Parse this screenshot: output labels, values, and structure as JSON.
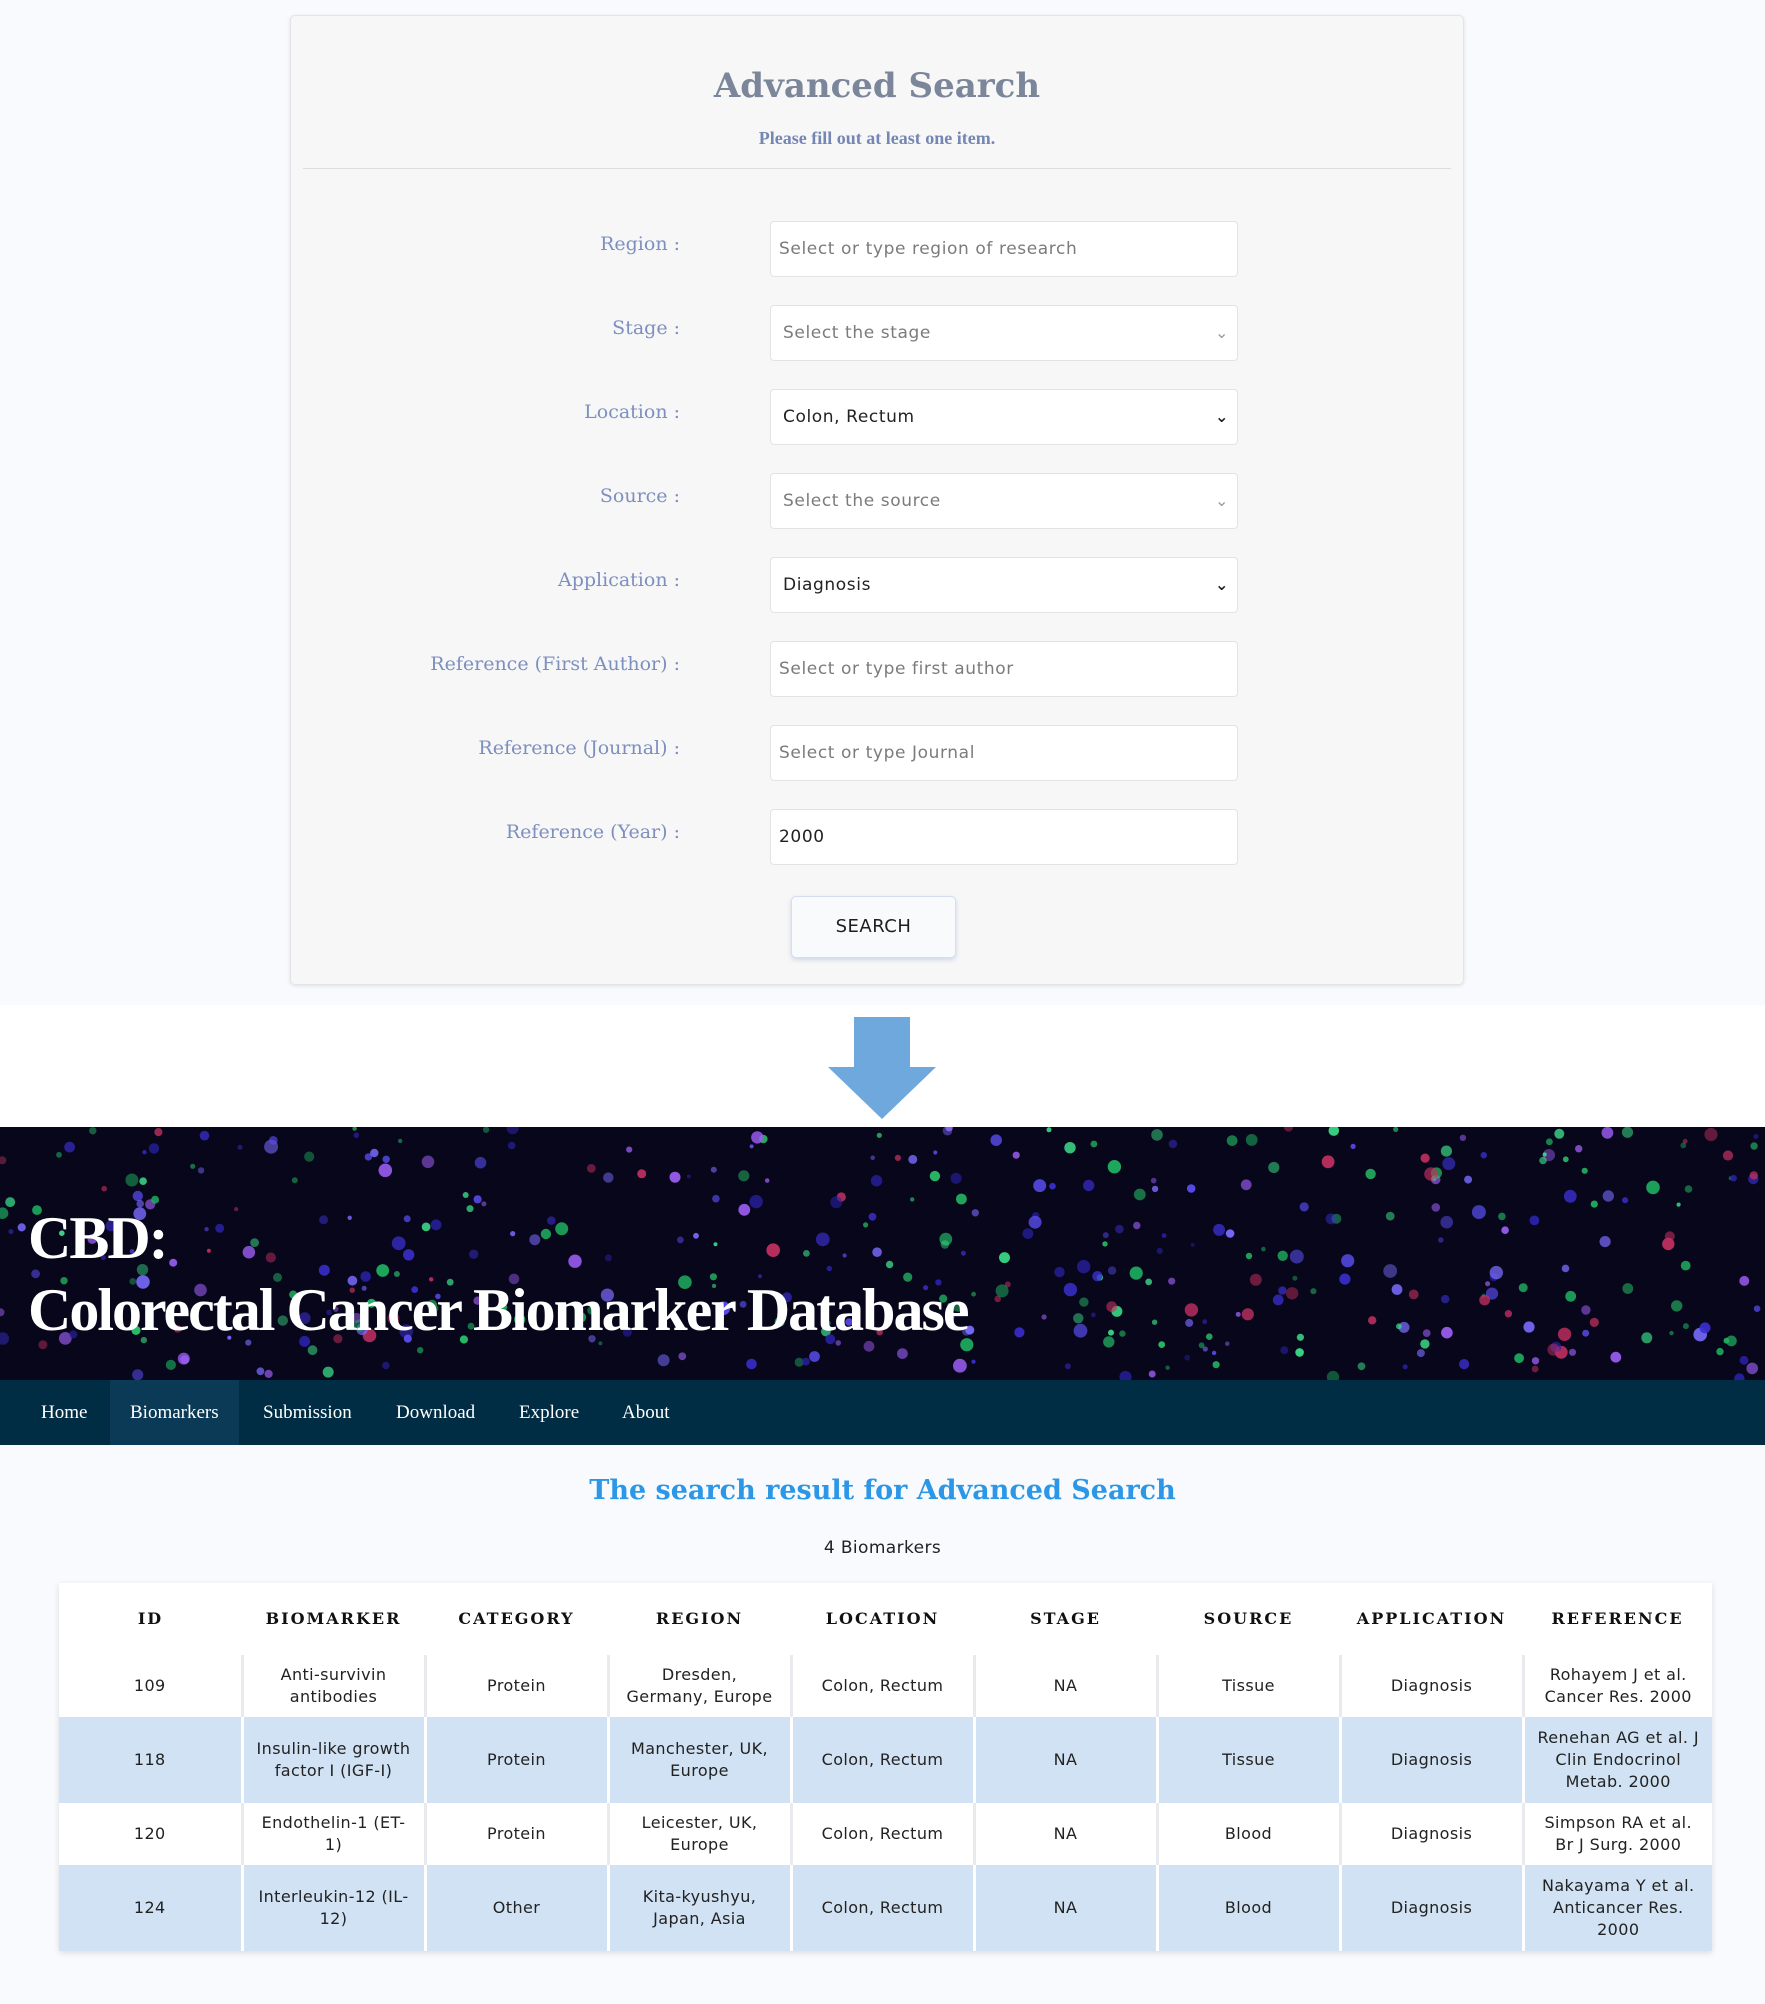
{
  "search_form": {
    "title": "Advanced Search",
    "subtitle": "Please fill out at least one item.",
    "fields": [
      {
        "label": "Region :",
        "type": "text",
        "value": "",
        "placeholder": "Select or type region of research"
      },
      {
        "label": "Stage :",
        "type": "select",
        "value": "",
        "placeholder": "Select the stage"
      },
      {
        "label": "Location :",
        "type": "select",
        "value": "Colon, Rectum",
        "placeholder": ""
      },
      {
        "label": "Source :",
        "type": "select",
        "value": "",
        "placeholder": "Select the source"
      },
      {
        "label": "Application :",
        "type": "select",
        "value": "Diagnosis",
        "placeholder": ""
      },
      {
        "label": "Reference (First Author) :",
        "type": "text",
        "value": "",
        "placeholder": "Select or type first author"
      },
      {
        "label": "Reference (Journal) :",
        "type": "text",
        "value": "",
        "placeholder": "Select or type Journal"
      },
      {
        "label": "Reference (Year) :",
        "type": "text",
        "value": "2000",
        "placeholder": ""
      }
    ],
    "search_button": "SEARCH"
  },
  "arrow": {
    "icon": "down-arrow-icon",
    "color": "#6fa8dc"
  },
  "banner": {
    "title_line1": "CBD:",
    "title_line2": "Colorectal Cancer Biomarker Database"
  },
  "nav": {
    "items": [
      "Home",
      "Biomarkers",
      "Submission",
      "Download",
      "Explore",
      "About"
    ],
    "active": "Biomarkers"
  },
  "results": {
    "heading": "The search result for Advanced Search",
    "count": "4 Biomarkers",
    "columns": [
      "ID",
      "BIOMARKER",
      "CATEGORY",
      "REGION",
      "LOCATION",
      "STAGE",
      "SOURCE",
      "APPLICATION",
      "REFERENCE"
    ],
    "rows": [
      [
        "109",
        "Anti-survivin antibodies",
        "Protein",
        "Dresden, Germany, Europe",
        "Colon, Rectum",
        "NA",
        "Tissue",
        "Diagnosis",
        "Rohayem J et al. Cancer Res. 2000"
      ],
      [
        "118",
        "Insulin-like growth factor I (IGF-I)",
        "Protein",
        "Manchester, UK, Europe",
        "Colon, Rectum",
        "NA",
        "Tissue",
        "Diagnosis",
        "Renehan AG et al. J Clin Endocrinol Metab. 2000"
      ],
      [
        "120",
        "Endothelin-1 (ET-1)",
        "Protein",
        "Leicester, UK, Europe",
        "Colon, Rectum",
        "NA",
        "Blood",
        "Diagnosis",
        "Simpson RA et al. Br J Surg. 2000"
      ],
      [
        "124",
        "Interleukin-12 (IL-12)",
        "Other",
        "Kita-kyushyu, Japan, Asia",
        "Colon, Rectum",
        "NA",
        "Blood",
        "Diagnosis",
        "Nakayama Y et al. Anticancer Res. 2000"
      ]
    ]
  },
  "colors": {
    "heading_blue": "#2b97e6",
    "nav_bg": "#002c44",
    "row_highlight": "#d0e2f3"
  }
}
